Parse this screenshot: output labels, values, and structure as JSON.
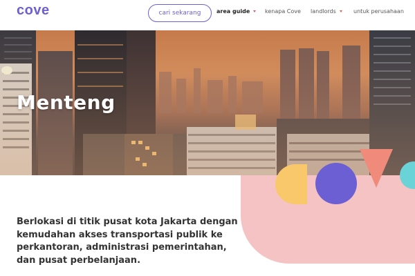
{
  "header": {
    "logo": "cove",
    "cta_label": "cari sekarang",
    "nav": [
      {
        "label": "area guide",
        "dropdown": true
      },
      {
        "label": "kenapa Cove",
        "dropdown": false
      },
      {
        "label": "landlords",
        "dropdown": true
      },
      {
        "label": "untuk perusahaan",
        "dropdown": false
      }
    ]
  },
  "hero": {
    "title": "Menteng"
  },
  "description": "Berlokasi di titik pusat kota Jakarta dengan kemudahan akses transportasi publik ke perkantoran, administrasi pemerintahan, dan pusat perbelanjaan.",
  "colors": {
    "brand": "#6b5fd3",
    "accent": "#e85a5a",
    "pink": "#f5c3c4",
    "yellow": "#f9c86b",
    "coral": "#f08a7a"
  }
}
